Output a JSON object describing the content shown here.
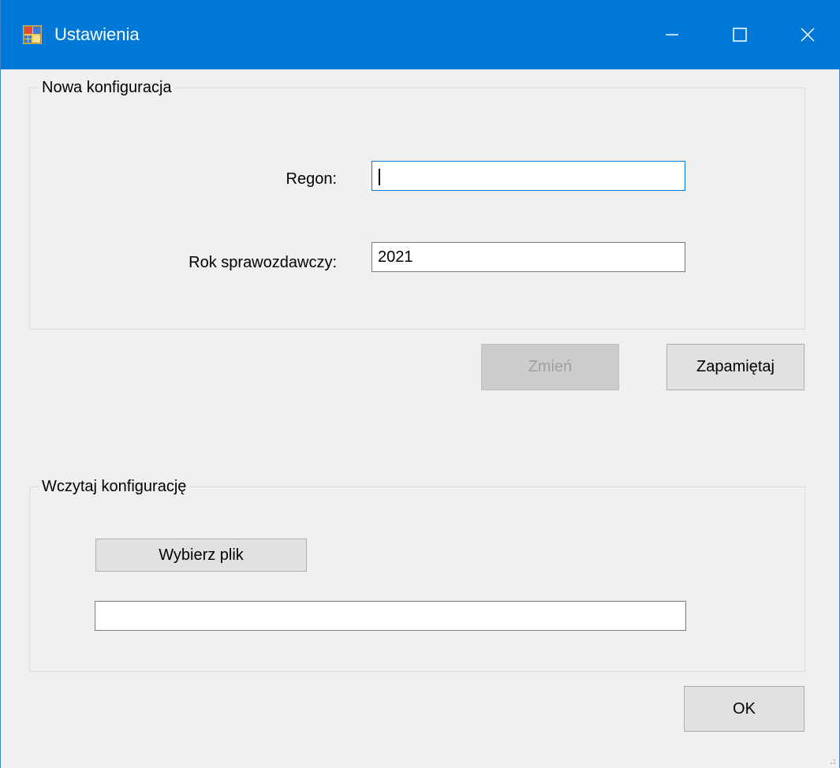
{
  "window": {
    "title": "Ustawienia",
    "icon": "app-window-icon",
    "controls": {
      "minimize": "minimize-icon",
      "maximize": "maximize-icon",
      "close": "close-icon"
    }
  },
  "new_config": {
    "group_label": "Nowa konfiguracja",
    "regon_label": "Regon:",
    "regon_value": "",
    "year_label": "Rok sprawozdawczy:",
    "year_value": "2021",
    "change_button": "Zmień",
    "save_button": "Zapamiętaj"
  },
  "load_config": {
    "group_label": "Wczytaj konfigurację",
    "choose_file_button": "Wybierz plik",
    "file_path_value": ""
  },
  "ok_button": "OK",
  "colors": {
    "titlebar": "#0078d7",
    "window_bg": "#f0f0f0",
    "button_bg": "#e1e1e1",
    "disabled_button_bg": "#cccccc"
  }
}
